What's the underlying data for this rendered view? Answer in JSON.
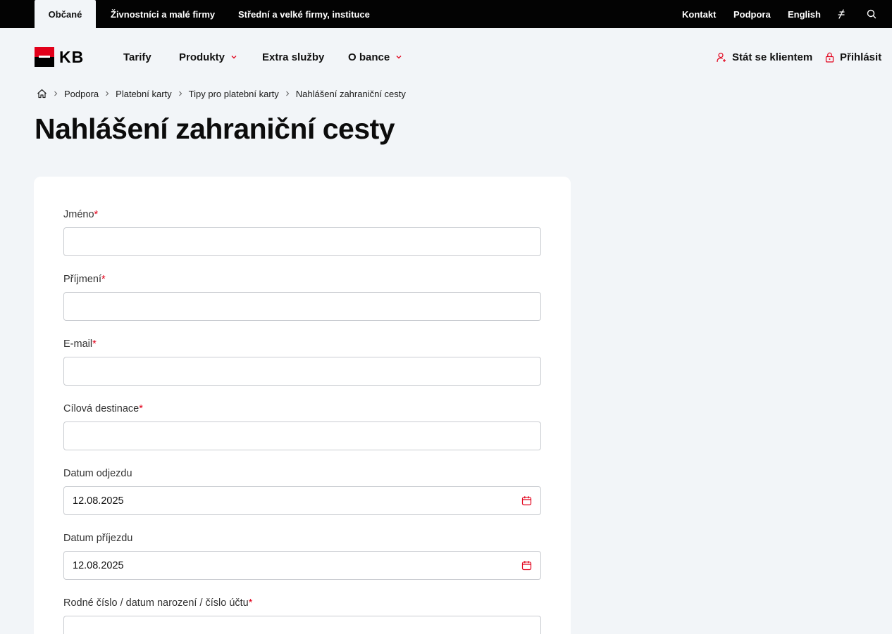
{
  "topbar": {
    "segments": [
      "Občané",
      "Živnostníci a malé firmy",
      "Střední a velké firmy, instituce"
    ],
    "links": [
      "Kontakt",
      "Podpora",
      "English"
    ],
    "icons": [
      "accessibility-icon",
      "search-icon"
    ]
  },
  "header": {
    "logo_text": "KB",
    "nav": [
      "Tarify",
      "Produkty",
      "Extra služby",
      "O bance"
    ],
    "become_client": "Stát se klientem",
    "login": "Přihlásit"
  },
  "breadcrumb": [
    "Podpora",
    "Platební karty",
    "Tipy pro platební karty",
    "Nahlášení zahraniční cesty"
  ],
  "page_title": "Nahlášení zahraniční cesty",
  "form": {
    "required_mark": "*",
    "fields": [
      {
        "label": "Jméno",
        "required": true,
        "value": ""
      },
      {
        "label": "Příjmení",
        "required": true,
        "value": ""
      },
      {
        "label": "E-mail",
        "required": true,
        "value": ""
      },
      {
        "label": "Cílová destinace",
        "required": true,
        "value": ""
      },
      {
        "label": "Datum odjezdu",
        "required": false,
        "value": "12.08.2025"
      },
      {
        "label": "Datum příjezdu",
        "required": false,
        "value": "12.08.2025"
      },
      {
        "label": "Rodné číslo / datum narození / číslo účtu",
        "required": true,
        "value": ""
      }
    ]
  },
  "colors": {
    "brand_red": "#e2001a",
    "topbar_bg": "#030303",
    "page_bg": "#f2f5f8"
  }
}
